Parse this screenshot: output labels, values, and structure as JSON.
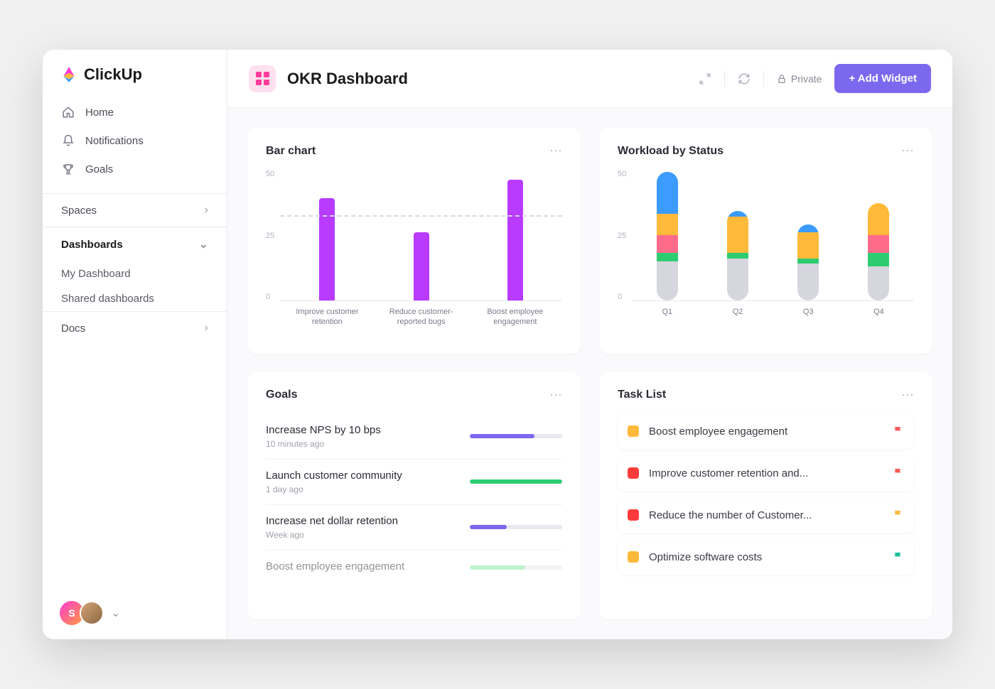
{
  "brand": "ClickUp",
  "sidebar": {
    "nav": [
      {
        "label": "Home"
      },
      {
        "label": "Notifications"
      },
      {
        "label": "Goals"
      }
    ],
    "spaces_label": "Spaces",
    "dashboards_label": "Dashboards",
    "dashboards_items": [
      {
        "label": "My Dashboard"
      },
      {
        "label": "Shared dashboards"
      }
    ],
    "docs_label": "Docs",
    "avatar_letter": "S"
  },
  "header": {
    "title": "OKR Dashboard",
    "privacy": "Private",
    "add_widget": "+ Add Widget"
  },
  "widgets": {
    "bar": {
      "title": "Bar chart"
    },
    "workload": {
      "title": "Workload by Status"
    },
    "goals": {
      "title": "Goals",
      "items": [
        {
          "name": "Increase NPS by 10 bps",
          "time": "10 minutes ago",
          "progress": 70,
          "color": "#7b68ee"
        },
        {
          "name": "Launch customer community",
          "time": "1 day ago",
          "progress": 100,
          "color": "#2ecc71"
        },
        {
          "name": "Increase net dollar retention",
          "time": "Week ago",
          "progress": 40,
          "color": "#7b68ee"
        },
        {
          "name": "Boost employee engagement",
          "time": "",
          "progress": 60,
          "color": "#7fe89a"
        }
      ]
    },
    "tasks": {
      "title": "Task List",
      "items": [
        {
          "name": "Boost employee engagement",
          "color": "#ffb93b",
          "flag": "#ff5a5a"
        },
        {
          "name": "Improve customer retention and...",
          "color": "#ff3b3b",
          "flag": "#ff5a5a"
        },
        {
          "name": "Reduce the number of Customer...",
          "color": "#ff3b3b",
          "flag": "#ffb93b"
        },
        {
          "name": "Optimize software costs",
          "color": "#ffb93b",
          "flag": "#1abc9c"
        }
      ]
    }
  },
  "chart_data": [
    {
      "type": "bar",
      "title": "Bar chart",
      "categories": [
        "Improve customer retention",
        "Reduce customer-reported bugs",
        "Boost employee engagement"
      ],
      "values": [
        39,
        26,
        46
      ],
      "ylim": [
        0,
        50
      ],
      "yticks": [
        0,
        25,
        50
      ],
      "reference_line": 32,
      "bar_color": "#b83bff"
    },
    {
      "type": "bar",
      "stacked": true,
      "title": "Workload by Status",
      "categories": [
        "Q1",
        "Q2",
        "Q3",
        "Q4"
      ],
      "ylim": [
        0,
        50
      ],
      "yticks": [
        0,
        25,
        50
      ],
      "series": [
        {
          "name": "grey",
          "color": "#d6d6de",
          "values": [
            15,
            16,
            14,
            13
          ]
        },
        {
          "name": "green",
          "color": "#2ecc71",
          "values": [
            3,
            2,
            2,
            5
          ]
        },
        {
          "name": "pink",
          "color": "#ff6b8a",
          "values": [
            7,
            0,
            0,
            7
          ]
        },
        {
          "name": "yellow",
          "color": "#ffb93b",
          "values": [
            8,
            14,
            10,
            12
          ]
        },
        {
          "name": "blue",
          "color": "#3b9bff",
          "values": [
            16,
            2,
            3,
            0
          ]
        }
      ]
    }
  ]
}
